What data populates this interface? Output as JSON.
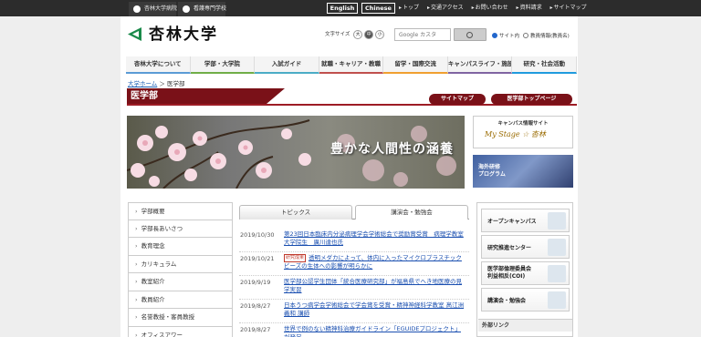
{
  "topbar": {
    "tabs": [
      "杏林大学病院",
      "看護専門学校"
    ],
    "lang_en": "English",
    "lang_cn": "Chinese",
    "links": [
      "トップ",
      "交通アクセス",
      "お問い合わせ",
      "資料請求",
      "サイトマップ"
    ]
  },
  "header": {
    "logo_text": "杏林大学",
    "font_size_label": "文字サイズ",
    "font_sizes": [
      "大",
      "中",
      "小"
    ],
    "search_placeholder": "Google カスタ",
    "radio_site": "サイト内",
    "radio_faculty": "教員情報(教員名)"
  },
  "nav": [
    "杏林大学について",
    "学部・大学院",
    "入試ガイド",
    "就職・キャリア・教職",
    "留学・国際交流",
    "キャンパスライフ・施設",
    "研究・社会活動"
  ],
  "breadcrumb": {
    "home": "大学ホーム",
    "sep": " ＞ ",
    "current": "医学部"
  },
  "title": {
    "text": "医学部",
    "sitemap": "サイトマップ",
    "faculty_top": "医学部トップページ"
  },
  "hero": {
    "caption": "豊かな人間性の涵養"
  },
  "banners": {
    "campus_top": "キャンパス情報サイト",
    "campus_main": "My Stage ☆ 杏林",
    "overseas": "海外研修\nプログラム"
  },
  "sidebar": [
    "学部概要",
    "学部長あいさつ",
    "教育理念",
    "カリキュラム",
    "教室紹介",
    "教員紹介",
    "名誉教授・客員教授",
    "オフィスアワー"
  ],
  "tabs": {
    "topics": "トピックス",
    "lectures": "講演会・勉強会"
  },
  "news": [
    {
      "date": "2019/10/30",
      "badge": "",
      "text": "第23回日本臨床内分泌病理学会学術総会で奨励賞受賞　病理学教室大学院生　廣川達也氏"
    },
    {
      "date": "2019/10/21",
      "badge": "研究成果",
      "text": "透明メダカによって、体内に入ったマイクロプラスチックビーズの生体への影響が明らかに"
    },
    {
      "date": "2019/9/19",
      "badge": "",
      "text": "医学部公認学生団体「統合医療研究部」が福島県でへき地医療の見学実習"
    },
    {
      "date": "2019/8/27",
      "badge": "",
      "text": "日本うつ病学会学術総会で学会賞を受賞・精神神経科学教室 髙江洲 義和 講師"
    },
    {
      "date": "2019/8/27",
      "badge": "",
      "text": "世界で例のない精神科治療ガイドライン「EGUIDEプロジェクト」が発足"
    }
  ],
  "right_buttons": [
    "オープンキャンパス",
    "研究推進センター",
    "医学部倫理委員会\n利益相反(COI)",
    "講演会・勉強会"
  ],
  "external_links": "外部リンク"
}
